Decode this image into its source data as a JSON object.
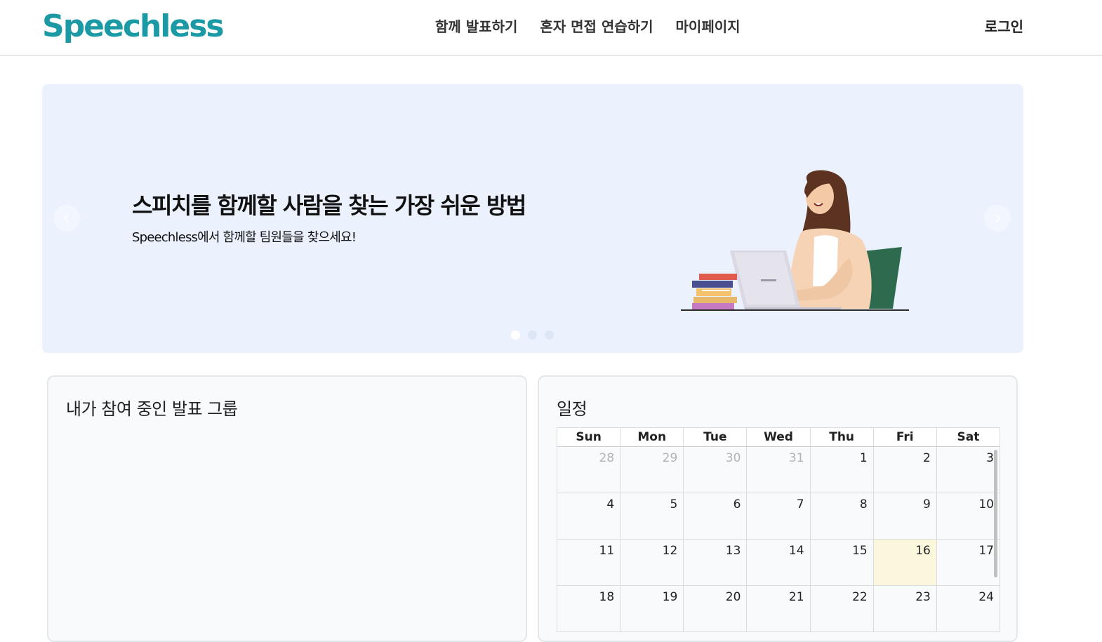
{
  "header": {
    "logo": "Speechless",
    "nav": [
      "함께 발표하기",
      "혼자 면접 연습하기",
      "마이페이지"
    ],
    "login": "로그인"
  },
  "banner": {
    "title": "스피치를 함께할 사람을 찾는 가장 쉬운 방법",
    "subtitle": "Speechless에서 함께할 팀원들을 찾으세요!",
    "prev_icon": "chevron-left-icon",
    "next_icon": "chevron-right-icon",
    "slide_count": 3,
    "active_slide": 1
  },
  "groups": {
    "title": "내가 참여 중인 발표 그룹"
  },
  "schedule": {
    "title": "일정",
    "weekdays": [
      "Sun",
      "Mon",
      "Tue",
      "Wed",
      "Thu",
      "Fri",
      "Sat"
    ],
    "weeks": [
      [
        "28",
        "29",
        "30",
        "31",
        "1",
        "2",
        "3"
      ],
      [
        "4",
        "5",
        "6",
        "7",
        "8",
        "9",
        "10"
      ],
      [
        "11",
        "12",
        "13",
        "14",
        "15",
        "16",
        "17"
      ],
      [
        "18",
        "19",
        "20",
        "21",
        "22",
        "23",
        "24"
      ]
    ],
    "muted_days": [
      "28",
      "29",
      "30",
      "31"
    ],
    "today": "16"
  },
  "colors": {
    "brand": "#1b9aa5",
    "banner_bg": "#ebf2fe",
    "today_bg": "#fbf7dd"
  }
}
